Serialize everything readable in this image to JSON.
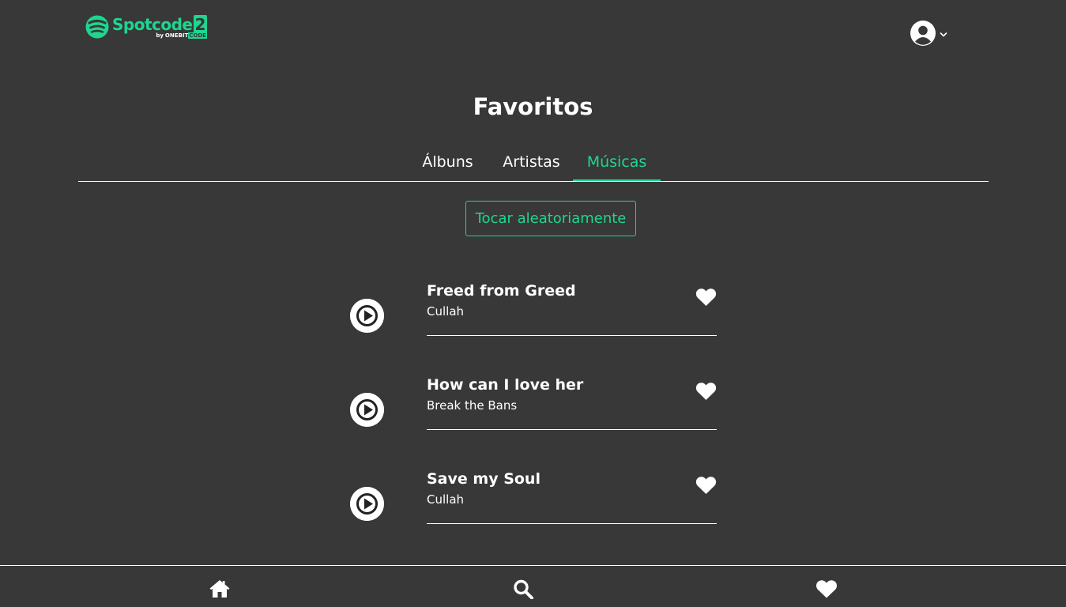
{
  "header": {
    "brand_name": "Spotcode",
    "brand_number": "2",
    "brand_by": "by",
    "brand_maker_one": "ONEBIT",
    "brand_maker_code": "CODE",
    "brand_color": "#1ed690",
    "user_icon": "user-circle-icon",
    "menu_icon": "chevron-down-icon"
  },
  "page": {
    "title": "Favoritos"
  },
  "tabs": [
    {
      "label": "Álbuns",
      "active": false
    },
    {
      "label": "Artistas",
      "active": false
    },
    {
      "label": "Músicas",
      "active": true
    }
  ],
  "shuffle_button": {
    "label": "Tocar aleatoriamente"
  },
  "songs": [
    {
      "title": "Freed from Greed",
      "artist": "Cullah",
      "favorite": true
    },
    {
      "title": "How can I love her",
      "artist": "Break the Bans",
      "favorite": true
    },
    {
      "title": "Save my Soul",
      "artist": "Cullah",
      "favorite": true
    }
  ],
  "bottom_nav": [
    {
      "icon": "home-icon"
    },
    {
      "icon": "search-icon"
    },
    {
      "icon": "heart-icon"
    }
  ],
  "colors": {
    "background": "#383838",
    "accent": "#1ed690",
    "text": "#ffffff"
  }
}
